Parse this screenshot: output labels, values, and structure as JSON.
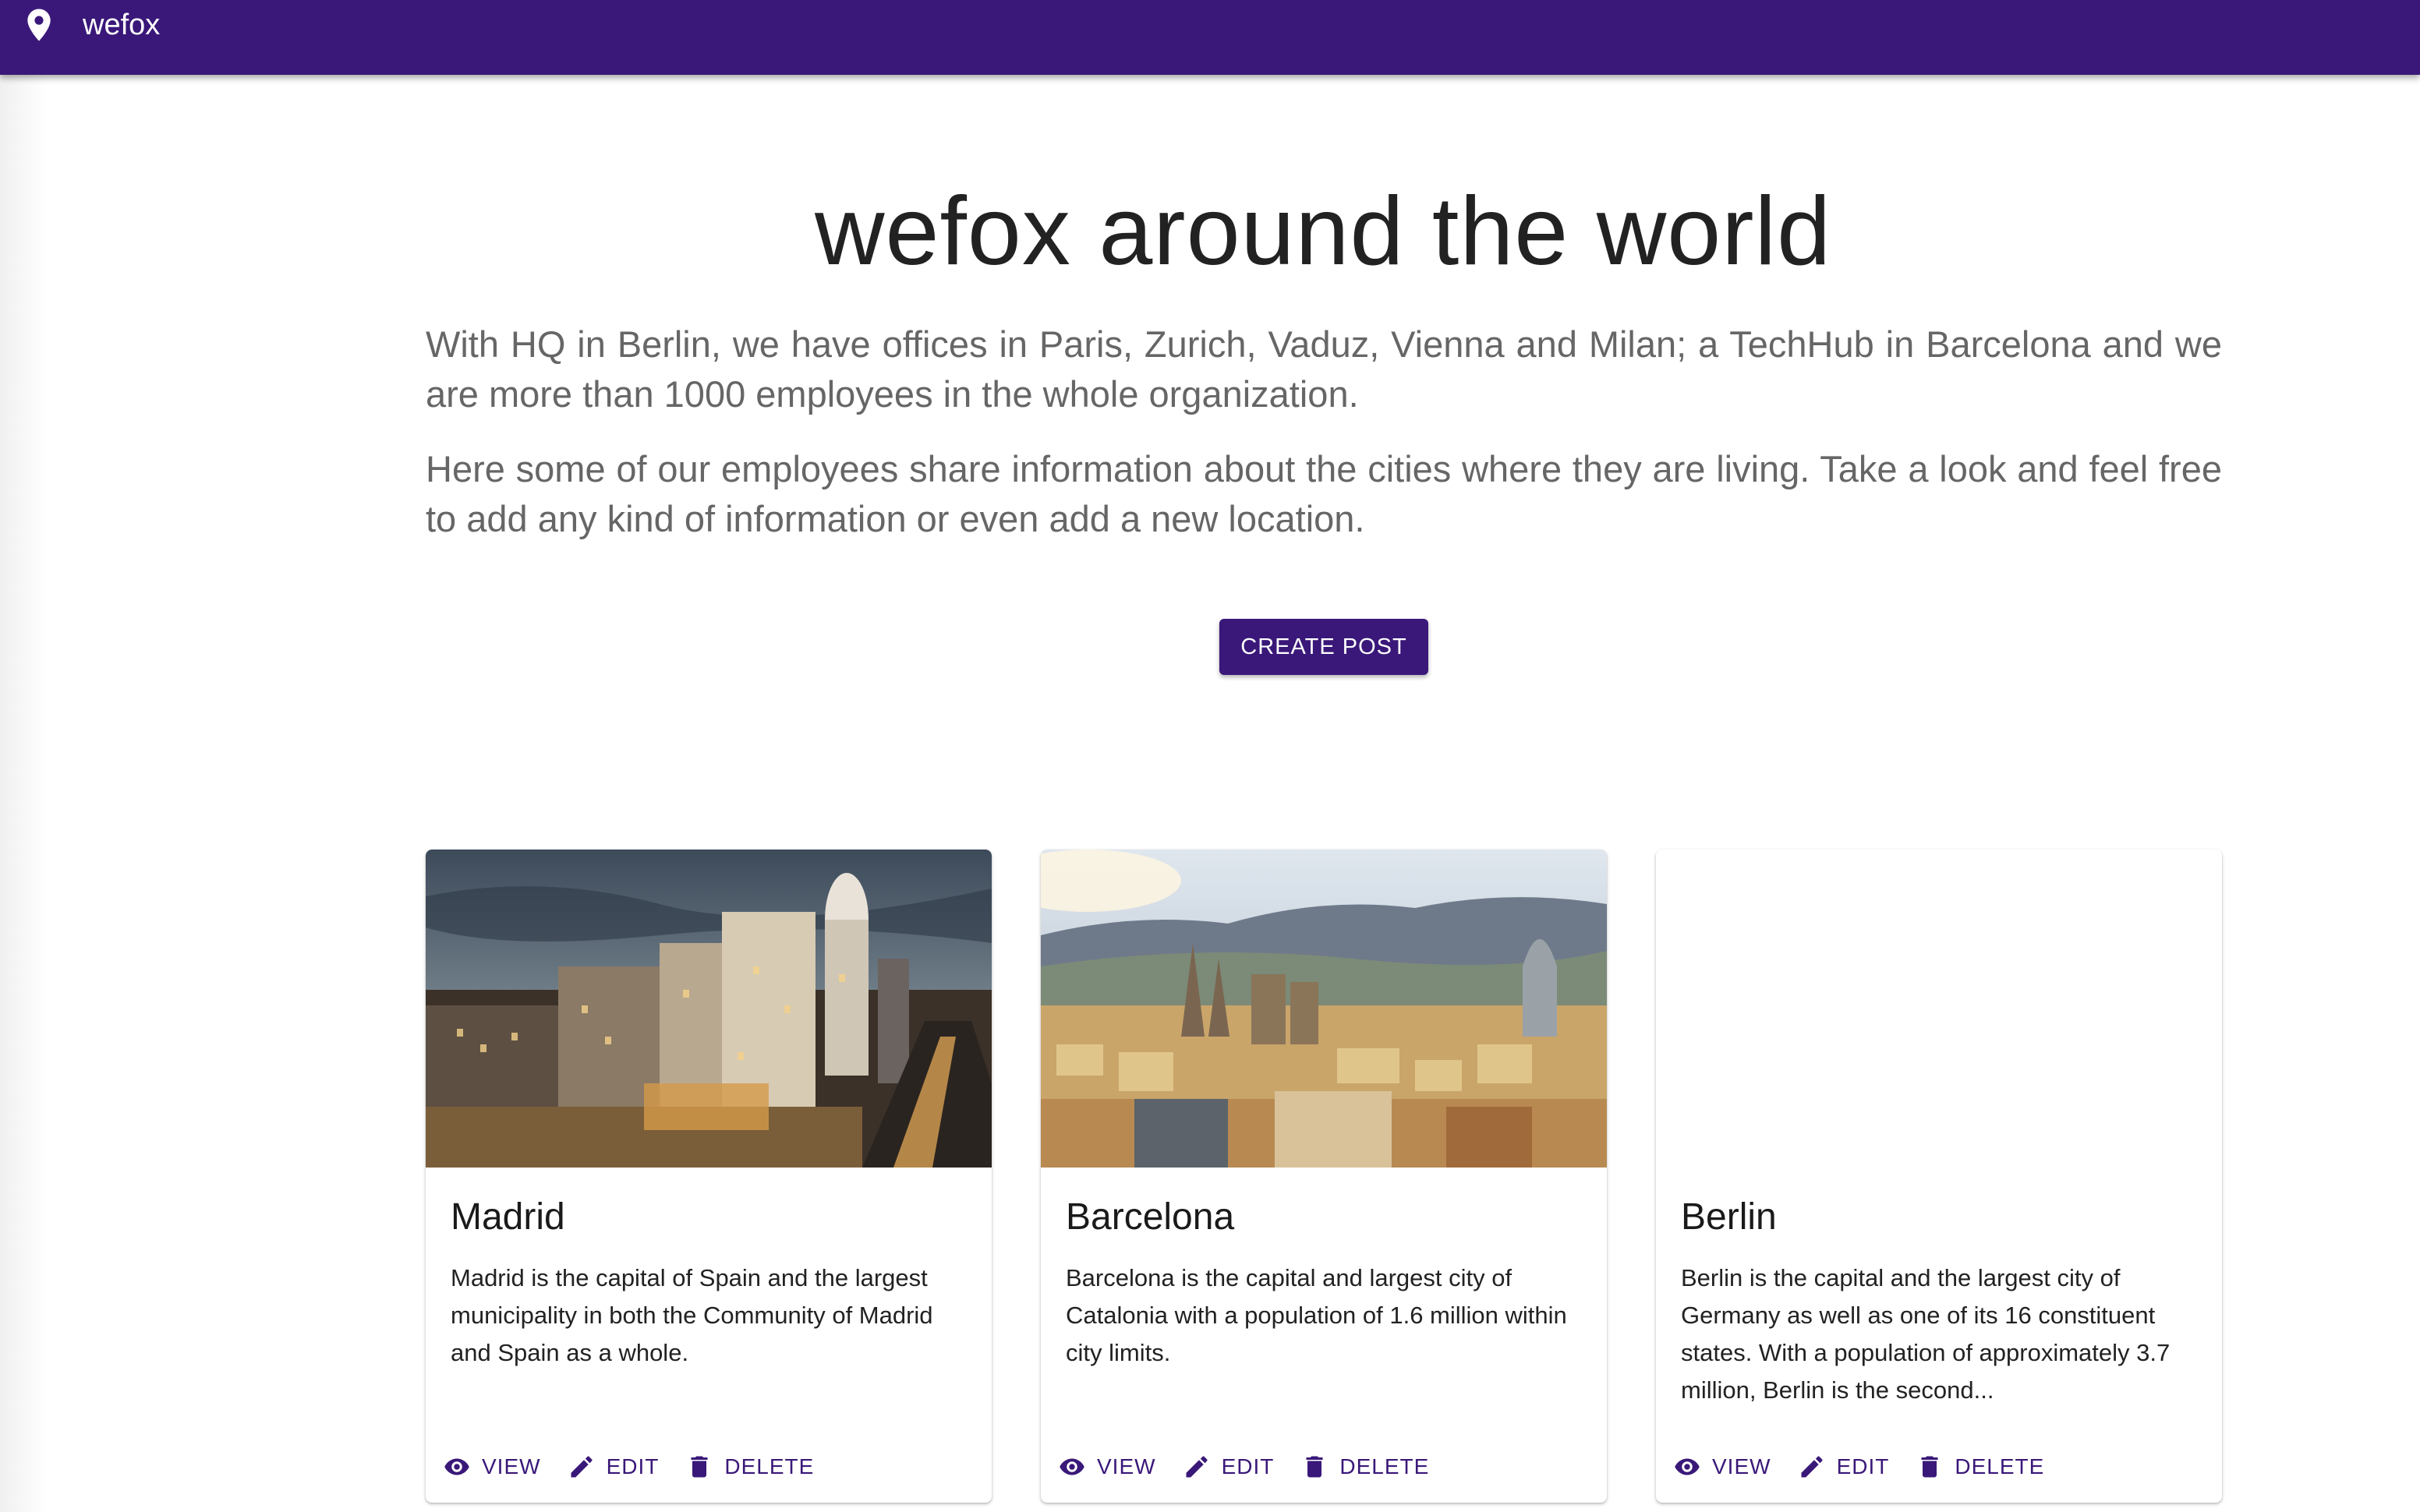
{
  "appbar": {
    "title": "wefox",
    "icon": "location-pin-icon",
    "color": "#3a1879"
  },
  "hero": {
    "title": "wefox around the world",
    "paragraph_1": "With HQ in Berlin, we have offices in Paris, Zurich, Vaduz, Vienna and Milan; a TechHub in Barcelona and we are more than 1000 employees in the whole organization.",
    "paragraph_2": "Here some of our employees share information about the cities where they are living. Take a look and feel free to add any kind of information or even add a new location.",
    "create_button": "CREATE POST"
  },
  "cards": [
    {
      "title": "Madrid",
      "description": "Madrid is the capital of Spain and the largest municipality in both the Community of Madrid and Spain as a whole.",
      "image": "madrid-city-photo",
      "actions": {
        "view": "VIEW",
        "edit": "EDIT",
        "delete": "DELETE"
      }
    },
    {
      "title": "Barcelona",
      "description": "Barcelona is the capital and largest city of Catalonia with a population of 1.6 million within city limits.",
      "image": "barcelona-city-photo",
      "actions": {
        "view": "VIEW",
        "edit": "EDIT",
        "delete": "DELETE"
      }
    },
    {
      "title": "Berlin",
      "description": "Berlin is the capital and the largest city of Germany as well as one of its 16 constituent states. With a population of approximately 3.7 million, Berlin is the second...",
      "image": "",
      "actions": {
        "view": "VIEW",
        "edit": "EDIT",
        "delete": "DELETE"
      }
    }
  ],
  "icons": {
    "view": "eye-icon",
    "edit": "pencil-icon",
    "delete": "trash-icon"
  }
}
